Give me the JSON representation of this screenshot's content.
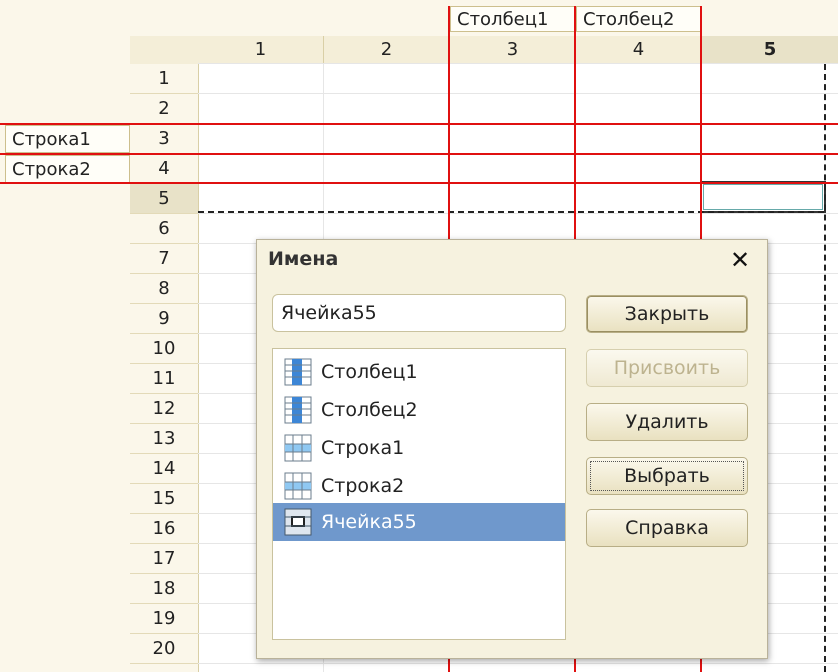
{
  "grid": {
    "column_headers": [
      "1",
      "2",
      "3",
      "4",
      "5"
    ],
    "row_headers": [
      "1",
      "2",
      "3",
      "4",
      "5",
      "6",
      "7",
      "8",
      "9",
      "10",
      "11",
      "12",
      "13",
      "14",
      "15",
      "16",
      "17",
      "18",
      "19",
      "20"
    ],
    "named_columns": [
      "Столбец1",
      "Столбец2"
    ],
    "named_rows": [
      "Строка1",
      "Строка2"
    ],
    "selected_column": "5",
    "selected_row": "5"
  },
  "dialog": {
    "title": "Имена",
    "close_glyph": "✕",
    "name_input_value": "Ячейка55",
    "items": [
      {
        "label": "Столбец1",
        "icon": "column-area-icon",
        "selected": false
      },
      {
        "label": "Столбец2",
        "icon": "column-area-icon",
        "selected": false
      },
      {
        "label": "Строка1",
        "icon": "row-area-icon",
        "selected": false
      },
      {
        "label": "Строка2",
        "icon": "row-area-icon",
        "selected": false
      },
      {
        "label": "Ячейка55",
        "icon": "cell-area-icon",
        "selected": true
      }
    ],
    "buttons": {
      "close": "Закрыть",
      "assign": "Присвоить",
      "delete": "Удалить",
      "select": "Выбрать",
      "help": "Справка"
    }
  },
  "colors": {
    "named_area_border": "#e01010",
    "selection_highlight": "#6f98cc",
    "panel_background": "#f6f2df"
  }
}
